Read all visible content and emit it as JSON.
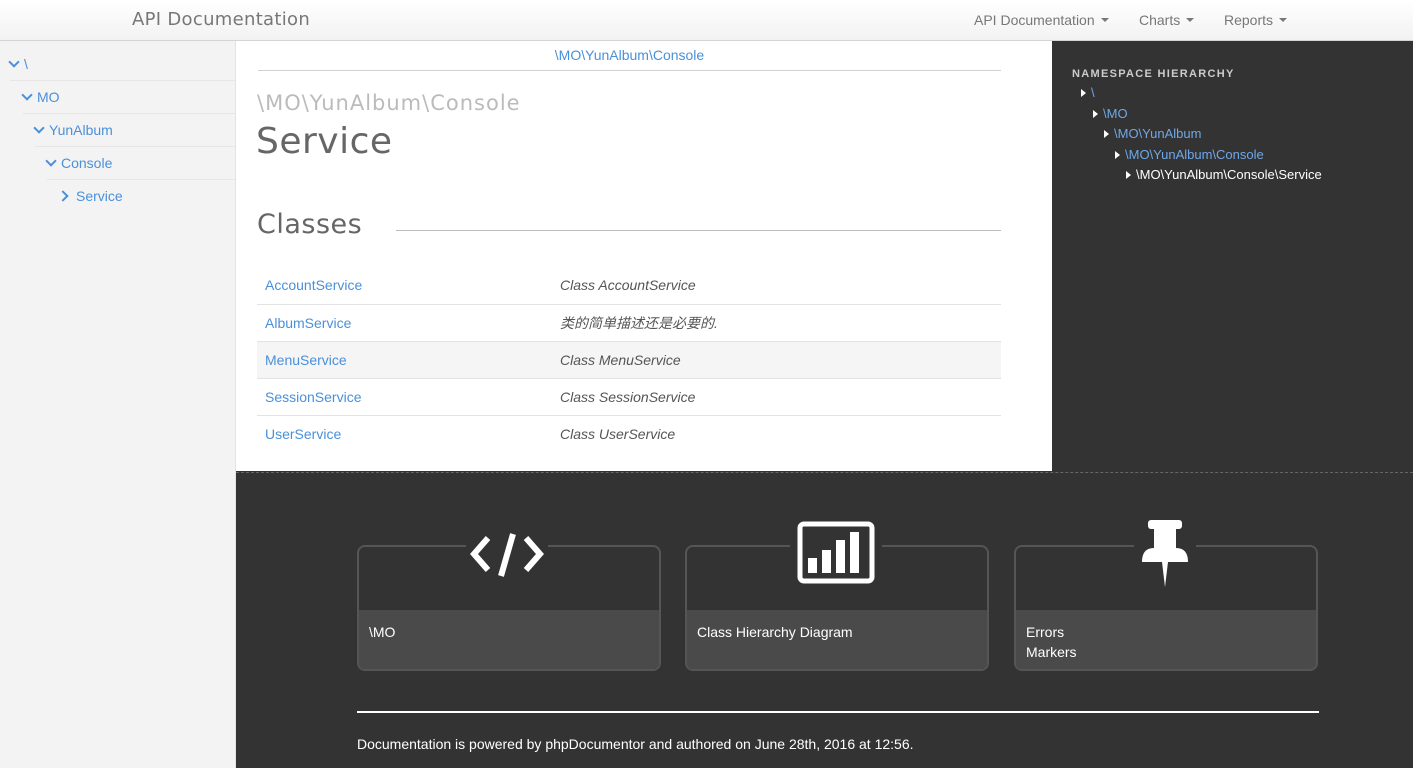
{
  "navbar": {
    "brand": "API Documentation",
    "menus": [
      "API Documentation",
      "Charts",
      "Reports"
    ]
  },
  "sidebar": {
    "items": [
      {
        "label": "\\",
        "state": "expanded"
      },
      {
        "label": "MO",
        "state": "expanded"
      },
      {
        "label": "YunAlbum",
        "state": "expanded"
      },
      {
        "label": "Console",
        "state": "expanded"
      },
      {
        "label": "Service",
        "state": "collapsed"
      }
    ]
  },
  "main": {
    "breadcrumb": "\\MO\\YunAlbum\\Console",
    "namespace": "\\MO\\YunAlbum\\Console",
    "title": "Service",
    "section_title": "Classes",
    "classes": [
      {
        "name": "AccountService",
        "description": "Class AccountService"
      },
      {
        "name": "AlbumService",
        "description": "类的简单描述还是必要的."
      },
      {
        "name": "MenuService",
        "description": "Class MenuService"
      },
      {
        "name": "SessionService",
        "description": "Class SessionService"
      },
      {
        "name": "UserService",
        "description": "Class UserService"
      }
    ]
  },
  "namespace_panel": {
    "heading": "NAMESPACE HIERARCHY",
    "items": [
      {
        "label": "\\",
        "current": false
      },
      {
        "label": "\\MO",
        "current": false
      },
      {
        "label": "\\MO\\YunAlbum",
        "current": false
      },
      {
        "label": "\\MO\\YunAlbum\\Console",
        "current": false
      },
      {
        "label": "\\MO\\YunAlbum\\Console\\Service",
        "current": true
      }
    ]
  },
  "footer": {
    "cards": [
      {
        "icon": "code-icon",
        "label": "\\MO"
      },
      {
        "icon": "bar-chart-icon",
        "label": "Class Hierarchy Diagram"
      },
      {
        "icon": "pushpin-icon",
        "label_line1": "Errors",
        "label_line2": "Markers"
      }
    ],
    "powered_by": "Documentation is powered by phpDocumentor and authored on June 28th, 2016 at 12:56."
  },
  "colors": {
    "link": "#4a90d9",
    "dark_bg": "#333333",
    "card_bottom": "#4a4a4a"
  }
}
